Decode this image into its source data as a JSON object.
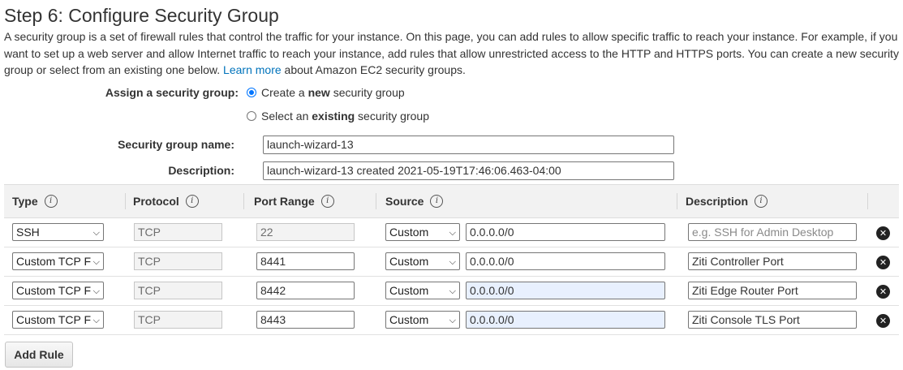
{
  "page": {
    "title": "Step 6: Configure Security Group",
    "intro": "A security group is a set of firewall rules that control the traffic for your instance. On this page, you can add rules to allow specific traffic to reach your instance. For example, if you want to set up a web server and allow Internet traffic to reach your instance, add rules that allow unrestricted access to the HTTP and HTTPS ports. You can create a new security group or select from an existing one below.",
    "learn_more": "Learn more",
    "intro_suffix": "about Amazon EC2 security groups."
  },
  "assign": {
    "label": "Assign a security group:",
    "options": [
      {
        "pre": "Create a ",
        "bold": "new",
        "post": " security group",
        "checked": true
      },
      {
        "pre": "Select an ",
        "bold": "existing",
        "post": " security group",
        "checked": false
      }
    ]
  },
  "form": {
    "name_label": "Security group name:",
    "name_value": "launch-wizard-13",
    "desc_label": "Description:",
    "desc_value": "launch-wizard-13 created 2021-05-19T17:46:06.463-04:00"
  },
  "table": {
    "headers": {
      "type": "Type",
      "protocol": "Protocol",
      "port_range": "Port Range",
      "source": "Source",
      "description": "Description"
    },
    "info_glyph": "i",
    "remove_glyph": "✕",
    "rows": [
      {
        "type": "SSH",
        "protocol": "TCP",
        "port": "22",
        "source_type": "Custom",
        "source": "0.0.0.0/0",
        "description": "",
        "description_placeholder": "e.g. SSH for Admin Desktop"
      },
      {
        "type": "Custom TCP F",
        "protocol": "TCP",
        "port": "8441",
        "source_type": "Custom",
        "source": "0.0.0.0/0",
        "description": "Ziti Controller Port",
        "description_placeholder": ""
      },
      {
        "type": "Custom TCP F",
        "protocol": "TCP",
        "port": "8442",
        "source_type": "Custom",
        "source": "0.0.0.0/0",
        "description": "Ziti Edge Router Port",
        "description_placeholder": ""
      },
      {
        "type": "Custom TCP F",
        "protocol": "TCP",
        "port": "8443",
        "source_type": "Custom",
        "source": "0.0.0.0/0",
        "description": "Ziti Console TLS Port",
        "description_placeholder": ""
      }
    ]
  },
  "buttons": {
    "add_rule": "Add Rule"
  },
  "colors": {
    "link": "#0073bb",
    "autofill": "#e8f0fe",
    "radio": "#0075ff"
  }
}
